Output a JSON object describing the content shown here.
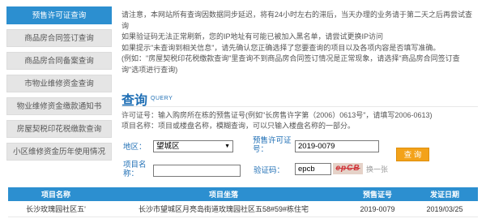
{
  "sidebar": {
    "items": [
      {
        "label": "预售许可证查询"
      },
      {
        "label": "商品房合同签订查询"
      },
      {
        "label": "商品房合同备案查询"
      },
      {
        "label": "市物业维修资金查询"
      },
      {
        "label": "物业维修资金缴款通知书"
      },
      {
        "label": "房屋契税印花税缴款查询"
      },
      {
        "label": "小区维修资金历年使用情况"
      }
    ]
  },
  "notice": {
    "line1": "请注意，本网站所有查询因数据同步延迟，将有24小时左右的滞后，当天办理的业务请于第二天之后再尝试查",
    "line1b": "询",
    "line2": "如果验证码无法正常刷新，您的IP地址有可能已被加入黑名单，请尝试更换IP访问",
    "line3": "如果提示\"未查询到相关信息\"，请先确认您正确选择了您要查询的项目以及各项内容是否填写准确。",
    "line4": "(例如：\"房屋契税印花税缴款查询\"里查询不到商品房合同签订情况是正常现象，请选择\"商品房合同签订查",
    "line4b": "询\"选项进行查询)"
  },
  "query": {
    "title": "查询",
    "subtitle": "QUERY",
    "help1": "许可证号：输入购房所在栋的预售证号(例如\"长房售许字第（2006）0613号\"，请填写2006-0613)",
    "help2": "项目名称：项目或楼盘名称，模糊查询，可以只输入楼盘名称的一部分。"
  },
  "form": {
    "district_label": "地区：",
    "district_value": "望城区",
    "permit_label_1": "预售许可证",
    "permit_label_2": "号：",
    "permit_value": "2019-0079",
    "project_label_1": "项目名",
    "project_label_2": "称：",
    "project_value": "",
    "captcha_label": "验证码：",
    "captcha_value": "epcb",
    "captcha_image_text": "epCB",
    "refresh_text": "换一张",
    "submit_label": "查 询"
  },
  "table": {
    "headers": [
      "项目名称",
      "项目坐落",
      "预售证号",
      "发证日期"
    ],
    "rows": [
      [
        "长沙玫瑰园社区五'",
        "长沙市望城区月亮岛街道玫瑰园社区五58#59#栋住宅",
        "2019-0079",
        "2019/03/25"
      ]
    ]
  },
  "colors": {
    "accent": "#2c8fd0",
    "title": "#1f6fb5",
    "button": "#f3a21a"
  }
}
